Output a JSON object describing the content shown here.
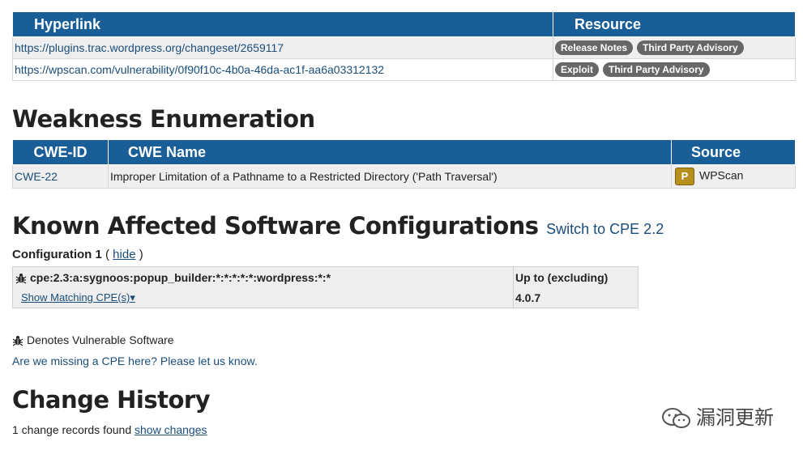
{
  "references": {
    "headers": [
      "Hyperlink",
      "Resource"
    ],
    "rows": [
      {
        "link": "https://plugins.trac.wordpress.org/changeset/2659117",
        "badges": [
          "Release Notes",
          "Third Party Advisory"
        ]
      },
      {
        "link": "https://wpscan.com/vulnerability/0f90f10c-4b0a-46da-ac1f-aa6a03312132",
        "badges": [
          "Exploit",
          "Third Party Advisory"
        ]
      }
    ]
  },
  "weakness": {
    "title": "Weakness Enumeration",
    "headers": [
      "CWE-ID",
      "CWE Name",
      "Source"
    ],
    "row": {
      "id": "CWE-22",
      "name": "Improper Limitation of a Pathname to a Restricted Directory ('Path Traversal')",
      "source": "WPScan",
      "source_icon_letter": "P"
    }
  },
  "configs": {
    "title": "Known Affected Software Configurations",
    "switch_link": "Switch to CPE 2.2",
    "label": "Configuration 1",
    "hide_open": "( ",
    "hide_link": "hide",
    "hide_close": " )",
    "cpe": "cpe:2.3:a:sygnoos:popup_builder:*:*:*:*:*:wordpress:*:*",
    "show_matching": "Show Matching CPE(s)",
    "range_label": "Up to (excluding)",
    "version": "4.0.7"
  },
  "legend": "Denotes Vulnerable Software",
  "missing": "Are we missing a CPE here? Please let us know.",
  "history": {
    "title": "Change History",
    "records_text": "1 change records found ",
    "show_changes": "show changes"
  },
  "watermark": "漏洞更新"
}
